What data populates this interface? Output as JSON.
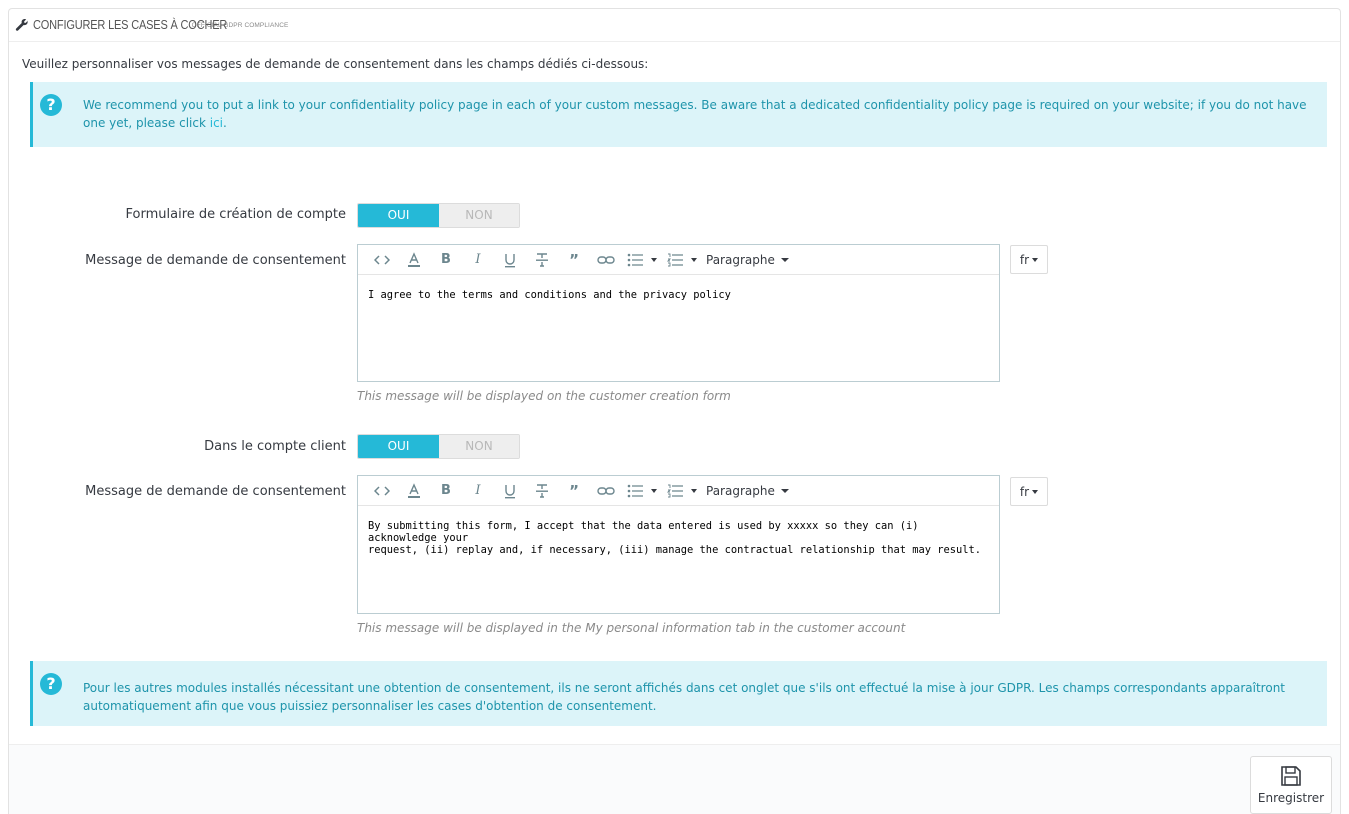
{
  "panel": {
    "title": "CONFIGURER LES CASES À COCHER",
    "subtitle": "OFFICIAL GDPR COMPLIANCE",
    "intro": "Veuillez personnaliser vos messages de demande de consentement dans les champs dédiés ci-dessous:"
  },
  "alert_top": {
    "text_before": "We recommend you to put a link to your confidentiality policy page in each of your custom messages. Be aware that a dedicated confidentiality policy page is required on your website; if you do not have one yet, please click ",
    "link": "ici",
    "text_after": "."
  },
  "account_form": {
    "label": "Formulaire de création de compte",
    "switch_on": "OUI",
    "switch_off": "NON",
    "message_label": "Message de demande de consentement",
    "paragraph_label": "Paragraphe",
    "content": "I agree to the terms and conditions and the privacy policy",
    "lang": "fr",
    "help": "This message will be displayed on the customer creation form"
  },
  "customer_account": {
    "label": "Dans le compte client",
    "switch_on": "OUI",
    "switch_off": "NON",
    "message_label": "Message de demande de consentement",
    "paragraph_label": "Paragraphe",
    "content_line1": "By submitting this form, I accept that the data entered is used by xxxxx so they can (i) acknowledge your",
    "content_line2": "request, (ii) replay and, if necessary, (iii) manage the contractual relationship that may result.",
    "lang": "fr",
    "help": "This message will be displayed in the My personal information tab in the customer account"
  },
  "alert_bottom": {
    "text": "Pour les autres modules installés nécessitant une obtention de consentement, ils ne seront affichés dans cet onglet que s'ils ont effectué la mise à jour GDPR. Les champs correspondants apparaîtront automatiquement afin que vous puissiez personnaliser les cases d'obtention de consentement."
  },
  "footer": {
    "save_label": "Enregistrer"
  },
  "colors": {
    "accent": "#25b9d7",
    "alert_bg": "#dcf4f9",
    "alert_text": "#1e94ab"
  }
}
